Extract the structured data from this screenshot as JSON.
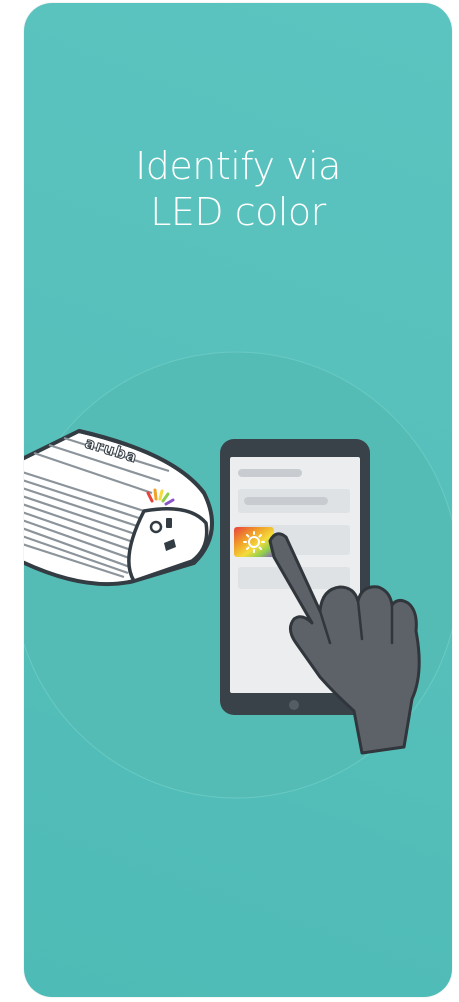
{
  "screen": {
    "title_line1": "Identify via",
    "title_line2": "LED color",
    "background_color": "#58c0bb",
    "text_color": "#ffffff"
  },
  "illustration": {
    "device_brand": "aruba",
    "icons": [
      "access-point-icon",
      "smartphone-icon",
      "hand-pointer-icon",
      "led-sun-icon"
    ]
  }
}
